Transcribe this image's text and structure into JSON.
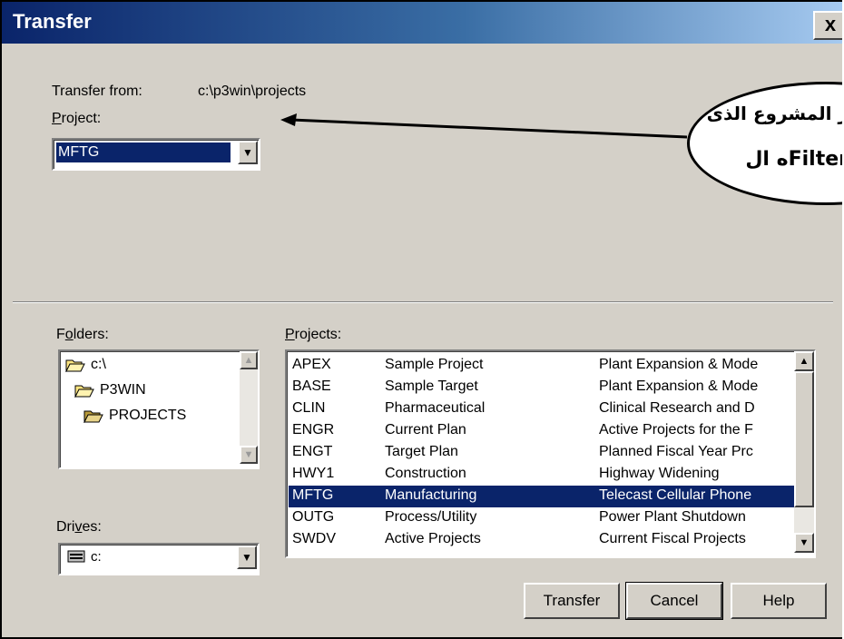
{
  "window": {
    "title": "Transfer",
    "close_label": "x"
  },
  "transfer_from": {
    "label": "Transfer from:",
    "value": "c:\\p3win\\projects"
  },
  "project": {
    "label": "Project:",
    "selected": "MFTG"
  },
  "folders": {
    "label": "Folders:",
    "items": [
      {
        "name": "c:\\",
        "icon": "open-folder-icon"
      },
      {
        "name": "P3WIN",
        "icon": "open-folder-icon"
      },
      {
        "name": "PROJECTS",
        "icon": "open-folder-icon"
      }
    ]
  },
  "drives": {
    "label": "Drives:",
    "selected": "c:",
    "icon": "drive-icon"
  },
  "projects": {
    "label": "Projects:",
    "rows": [
      {
        "code": "APEX",
        "name": "Sample Project",
        "desc": "Plant Expansion & Mode"
      },
      {
        "code": "BASE",
        "name": "Sample Target",
        "desc": "Plant Expansion & Mode"
      },
      {
        "code": "CLIN",
        "name": "Pharmaceutical",
        "desc": "Clinical Research and D"
      },
      {
        "code": "ENGR",
        "name": "Current Plan",
        "desc": "Active Projects for the F"
      },
      {
        "code": "ENGT",
        "name": "Target Plan",
        "desc": "Planned Fiscal Year Prc"
      },
      {
        "code": "HWY1",
        "name": "Construction",
        "desc": "Highway Widening"
      },
      {
        "code": "MFTG",
        "name": "Manufacturing",
        "desc": "Telecast Cellular Phone"
      },
      {
        "code": "OUTG",
        "name": "Process/Utility",
        "desc": "Power Plant Shutdown"
      },
      {
        "code": "SWDV",
        "name": "Active Projects",
        "desc": "Current Fiscal Projects"
      }
    ],
    "selected_index": 6
  },
  "buttons": {
    "transfer": "Transfer",
    "cancel": "Cancel",
    "help": "Help"
  },
  "annotation": {
    "line1": "ر المشروع الذى",
    "line2": "ه الFilter"
  },
  "colors": {
    "selection": "#0a246a",
    "title_start": "#0a246a",
    "dialog_bg": "#d4d0c8"
  }
}
